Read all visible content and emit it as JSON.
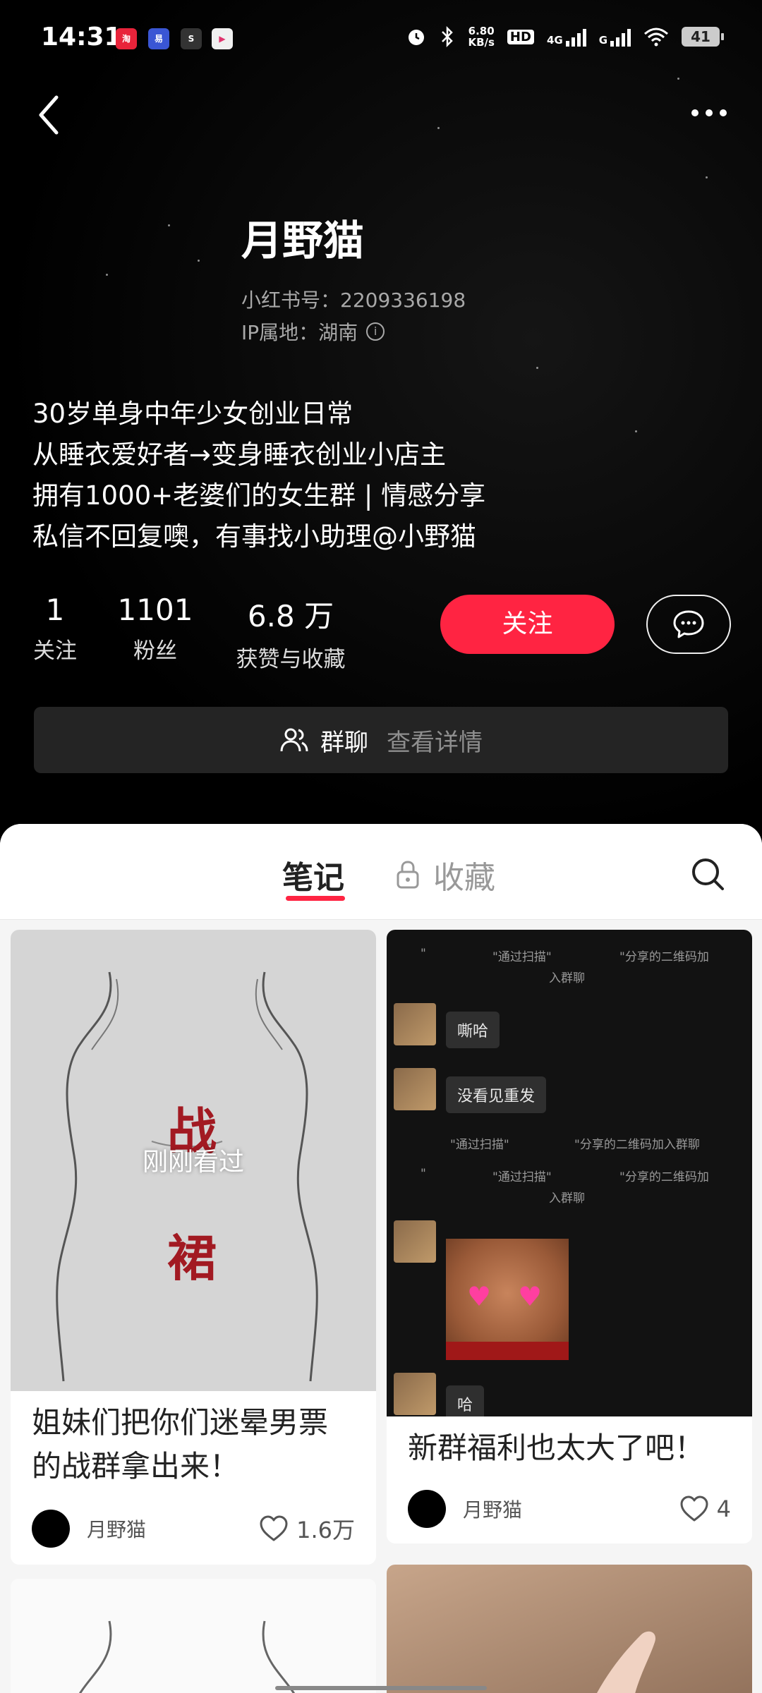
{
  "status_bar": {
    "time": "14:31",
    "net_speed_value": "6.80",
    "net_speed_unit": "KB/s",
    "hd_label": "HD",
    "network_1": "4G",
    "network_2": "G",
    "battery": "41"
  },
  "profile": {
    "name": "月野猫",
    "id_line": "小红书号：2209336198",
    "ip_line": "IP属地：湖南",
    "bio": [
      "30岁单身中年少女创业日常",
      "从睡衣爱好者→变身睡衣创业小店主",
      "拥有1000+老婆们的女生群 | 情感分享",
      "私信不回复噢，有事找小助理@小野猫"
    ]
  },
  "stats": {
    "following": {
      "value": "1",
      "label": "关注"
    },
    "followers": {
      "value": "1101",
      "label": "粉丝"
    },
    "likes": {
      "value": "6.8 万",
      "label": "获赞与收藏"
    }
  },
  "actions": {
    "follow_label": "关注"
  },
  "group_chat": {
    "label": "群聊",
    "detail": "查看详情"
  },
  "tabs": {
    "notes": "笔记",
    "collect": "收藏"
  },
  "cards": [
    {
      "title_lines": [
        "姐妹们把你们迷晕男票",
        "的战群拿出来！"
      ],
      "overlay": "刚刚看过",
      "image_chars": [
        "战",
        "裙"
      ],
      "author": "月野猫",
      "likes": "1.6万"
    },
    {
      "title_lines": [
        "新群福利也太大了吧！"
      ],
      "author": "月野猫",
      "likes": "4",
      "chat": {
        "notice_1a": "\"",
        "notice_1b": "\"通过扫描\"",
        "notice_1c": "\"分享的二维码加",
        "notice_1d": "入群聊",
        "bubble_1": "嘶哈",
        "bubble_2": "没看见重发",
        "notice_2a": "\"通过扫描\"",
        "notice_2b": "\"分享的二维码加入群聊",
        "notice_3a": "\"",
        "notice_3b": "\"通过扫描\"",
        "notice_3c": "\"分享的二维码加",
        "notice_3d": "入群聊",
        "bubble_3": "哈"
      }
    }
  ],
  "colors": {
    "accent": "#ff2442",
    "header_bg": "#000000",
    "group_bar_bg": "#242424"
  },
  "icons": {
    "back": "chevron-left-icon",
    "more": "more-dots-icon",
    "message": "chat-bubble-icon",
    "group": "group-users-icon",
    "lock": "lock-icon",
    "search": "search-icon",
    "like": "heart-outline-icon"
  }
}
